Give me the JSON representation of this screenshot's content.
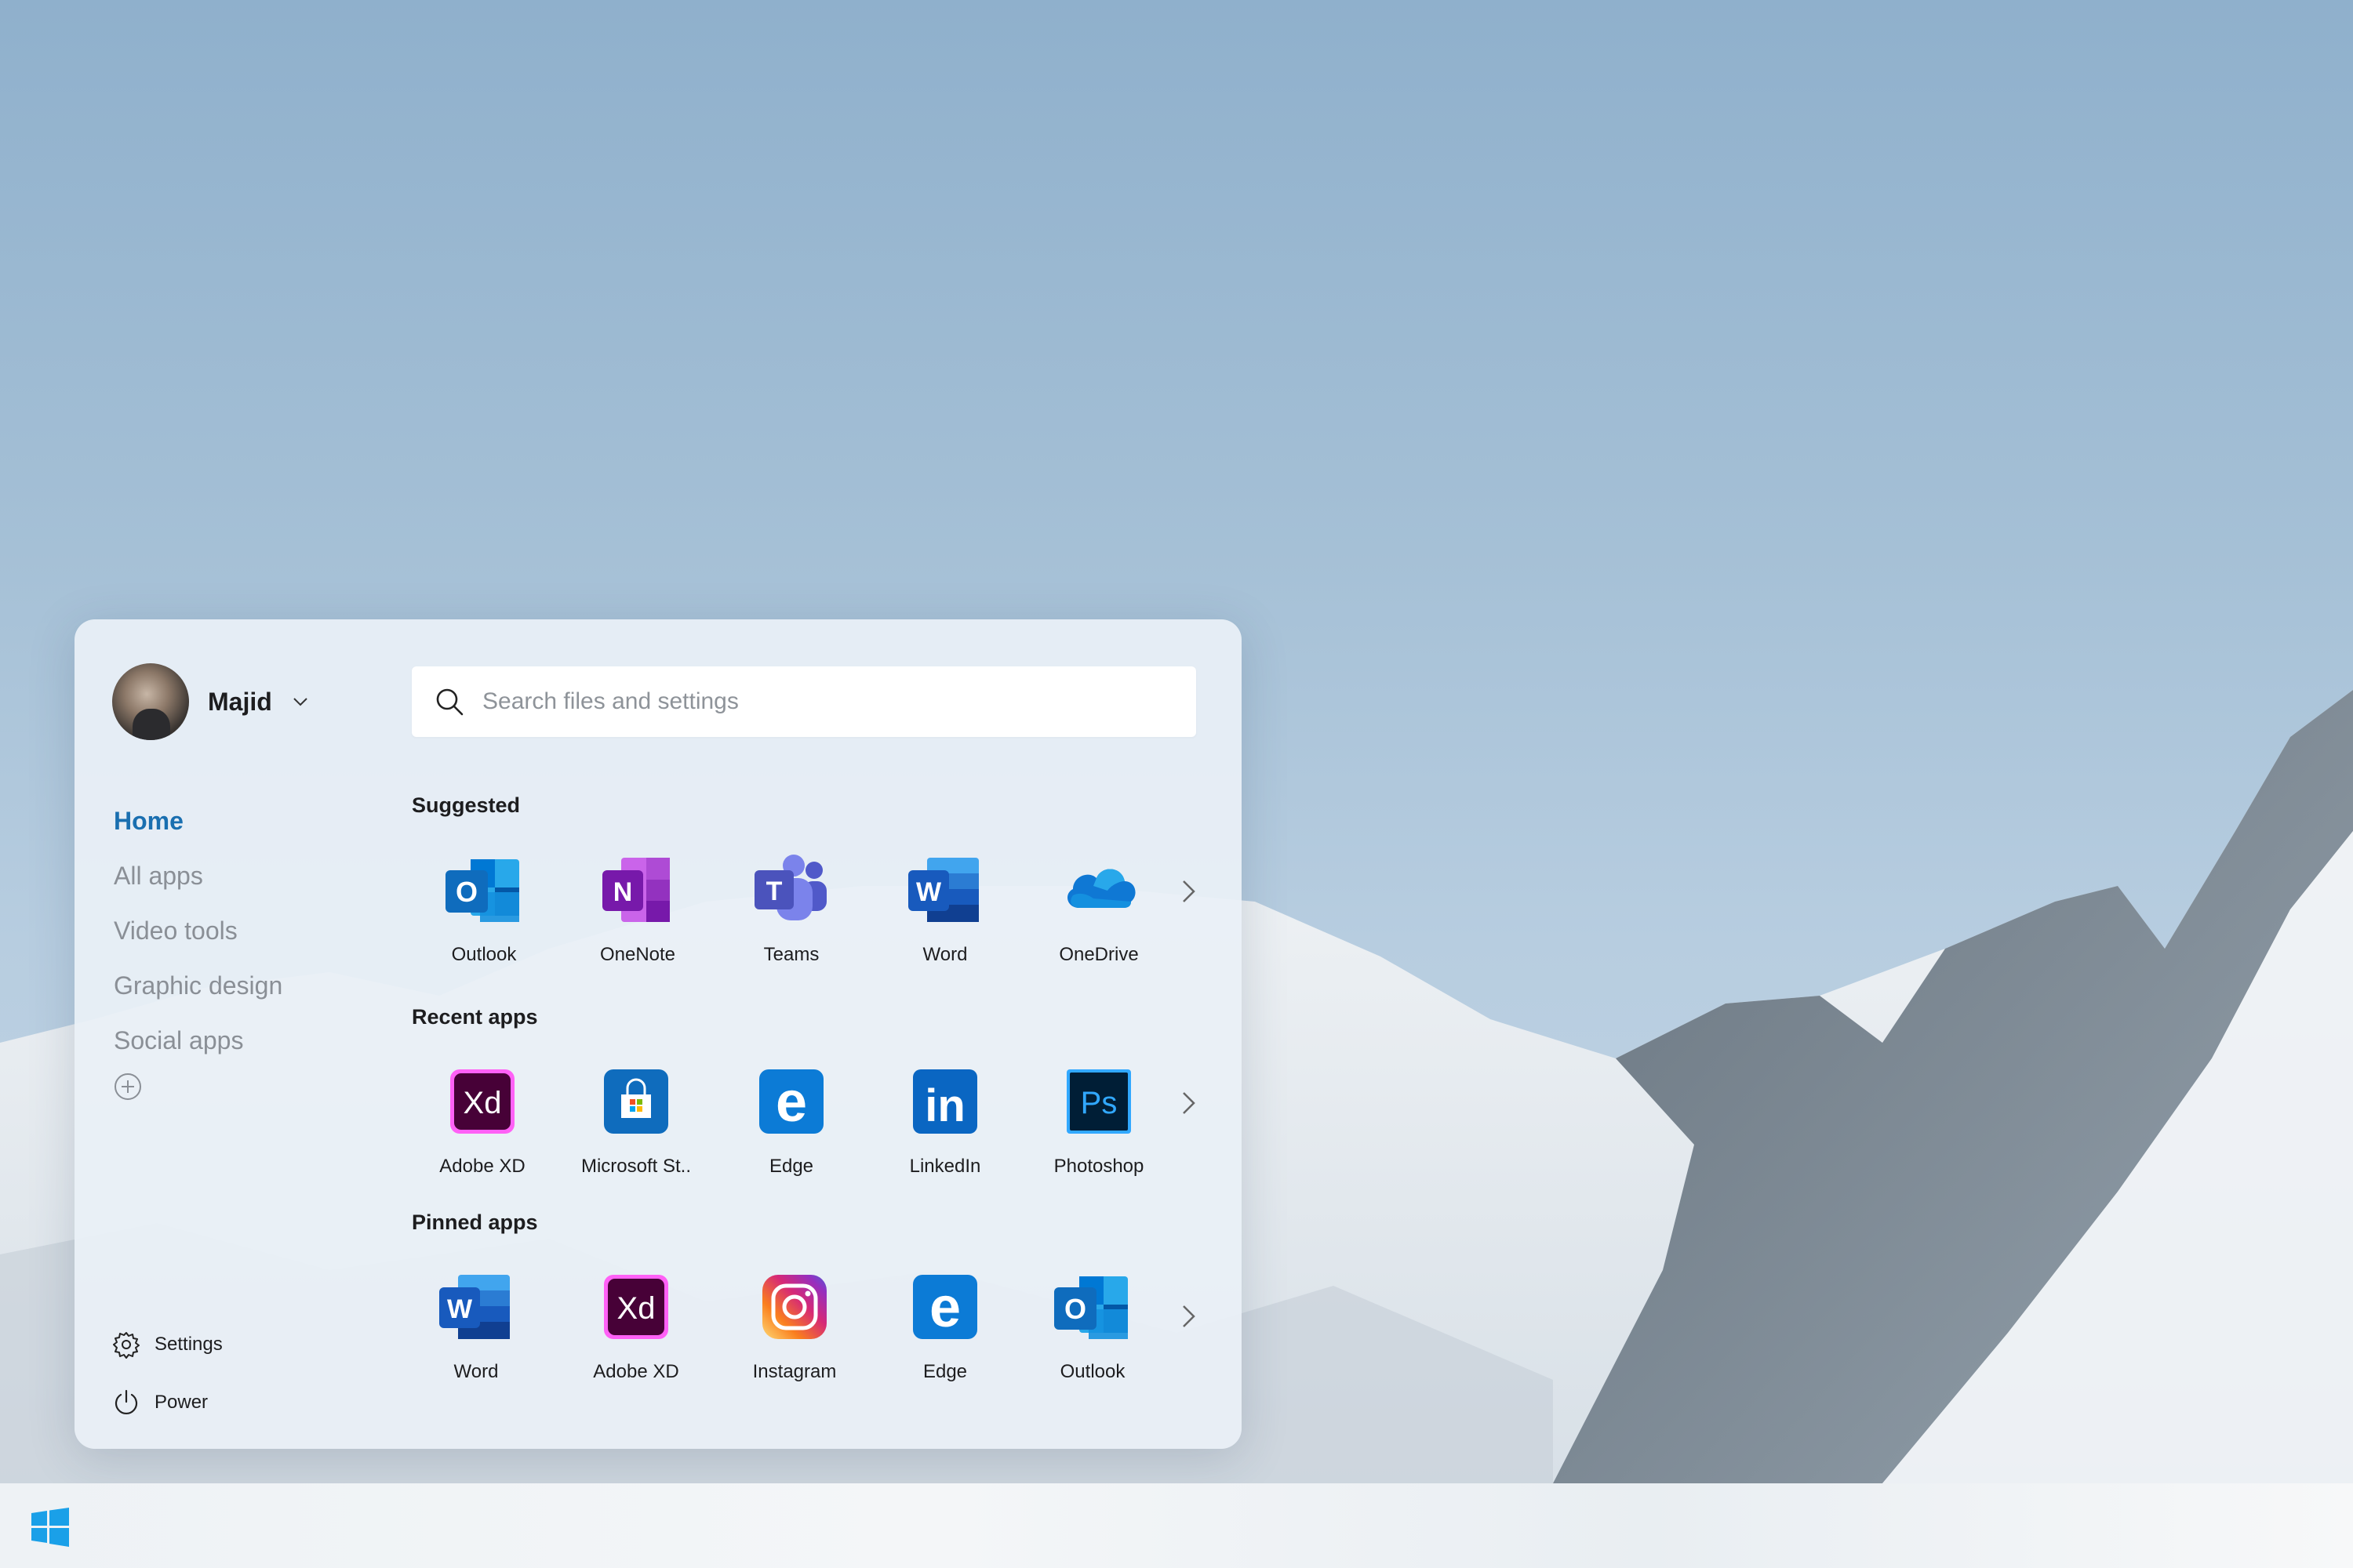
{
  "user": {
    "name": "Majid"
  },
  "search": {
    "placeholder": "Search files and settings"
  },
  "nav": {
    "items": [
      "Home",
      "All apps",
      "Video tools",
      "Graphic design",
      "Social apps"
    ],
    "active": "Home"
  },
  "bottom": {
    "settings_label": "Settings",
    "power_label": "Power"
  },
  "sections": {
    "suggested": {
      "title": "Suggested",
      "apps": [
        {
          "label": "Outlook",
          "icon": "outlook-icon"
        },
        {
          "label": "OneNote",
          "icon": "onenote-icon"
        },
        {
          "label": "Teams",
          "icon": "teams-icon"
        },
        {
          "label": "Word",
          "icon": "word-icon"
        },
        {
          "label": "OneDrive",
          "icon": "onedrive-icon"
        }
      ]
    },
    "recent": {
      "title": "Recent apps",
      "apps": [
        {
          "label": "Adobe XD",
          "icon": "adobe-xd-icon"
        },
        {
          "label": "Microsoft St..",
          "icon": "microsoft-store-icon"
        },
        {
          "label": "Edge",
          "icon": "edge-icon"
        },
        {
          "label": "LinkedIn",
          "icon": "linkedin-icon"
        },
        {
          "label": "Photoshop",
          "icon": "photoshop-icon"
        }
      ]
    },
    "pinned": {
      "title": "Pinned apps",
      "apps": [
        {
          "label": "Word",
          "icon": "word-icon"
        },
        {
          "label": "Adobe XD",
          "icon": "adobe-xd-icon"
        },
        {
          "label": "Instagram",
          "icon": "instagram-icon"
        },
        {
          "label": "Edge",
          "icon": "edge-icon"
        },
        {
          "label": "Outlook",
          "icon": "outlook-icon"
        }
      ]
    }
  },
  "icon_text": {
    "outlook": "O",
    "onenote": "N",
    "teams": "T",
    "word": "W",
    "xd": "Xd",
    "edge": "e",
    "linkedin": "in",
    "photoshop": "Ps"
  },
  "colors": {
    "accent": "#1a6fb0",
    "outlook": "#0f6cbd",
    "onenote": "#7b2fb7",
    "teams": "#5059c9",
    "word": "#185abd",
    "onedrive": "#0f78d4",
    "xd": "#470137",
    "xd_text": "#ff61f6",
    "edge": "#0c7bd6",
    "linkedin": "#0a66c2",
    "photoshop": "#001e36",
    "ps_text": "#31a8ff",
    "windows": "#1aa0e8"
  }
}
